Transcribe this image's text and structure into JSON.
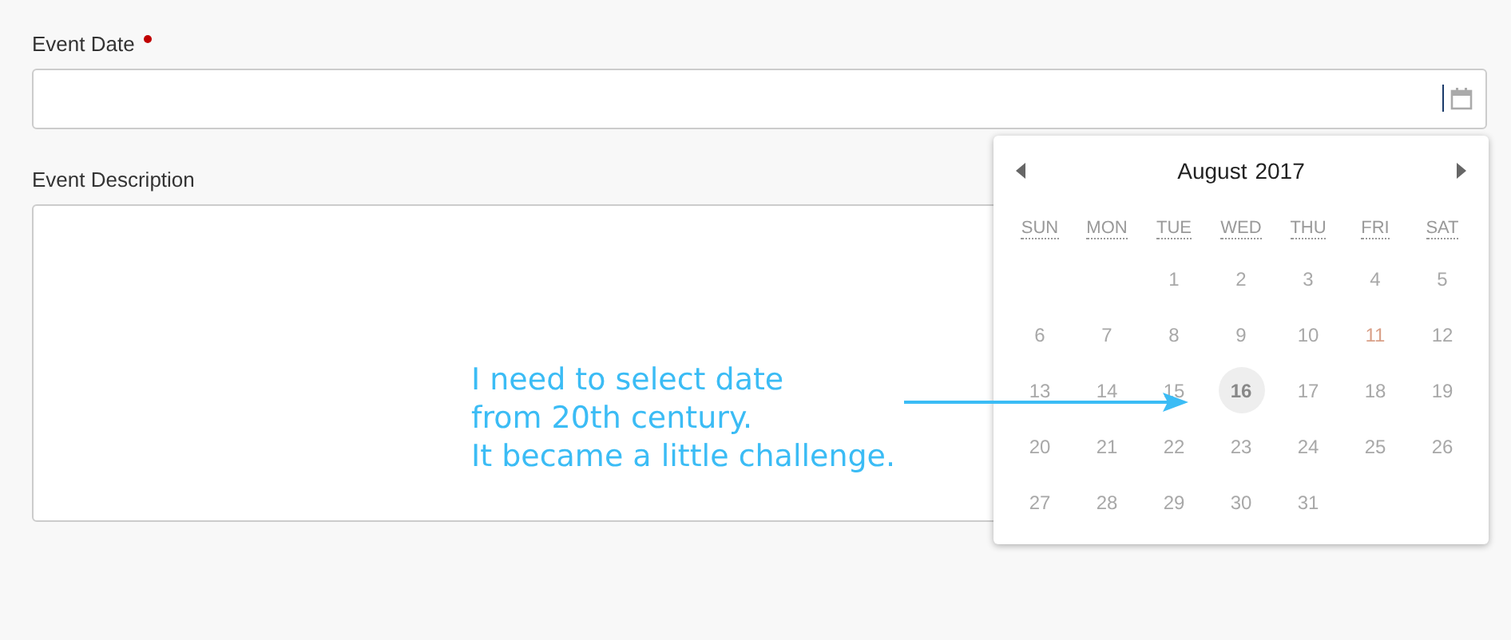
{
  "event_date": {
    "label": "Event Date",
    "required": true
  },
  "event_description": {
    "label": "Event Description"
  },
  "calendar": {
    "month": "August",
    "year": "2017",
    "weekdays": [
      "SUN",
      "MON",
      "TUE",
      "WED",
      "THU",
      "FRI",
      "SAT"
    ],
    "weeks": [
      {
        "days": [
          {
            "label": "1",
            "selected": false,
            "holiday": false
          },
          {
            "label": "2",
            "selected": false,
            "holiday": false
          },
          {
            "label": "3",
            "selected": false,
            "holiday": false
          },
          {
            "label": "4",
            "selected": false,
            "holiday": false
          },
          {
            "label": "5",
            "selected": false,
            "holiday": false
          }
        ]
      },
      {
        "days": [
          {
            "label": "6",
            "selected": false,
            "holiday": false
          },
          {
            "label": "7",
            "selected": false,
            "holiday": false
          },
          {
            "label": "8",
            "selected": false,
            "holiday": false
          },
          {
            "label": "9",
            "selected": false,
            "holiday": false
          },
          {
            "label": "10",
            "selected": false,
            "holiday": false
          },
          {
            "label": "11",
            "selected": false,
            "holiday": true
          },
          {
            "label": "12",
            "selected": false,
            "holiday": false
          }
        ]
      },
      {
        "days": [
          {
            "label": "13",
            "selected": false,
            "holiday": false
          },
          {
            "label": "14",
            "selected": false,
            "holiday": false
          },
          {
            "label": "15",
            "selected": false,
            "holiday": false
          },
          {
            "label": "16",
            "selected": true,
            "holiday": false
          },
          {
            "label": "17",
            "selected": false,
            "holiday": false
          },
          {
            "label": "18",
            "selected": false,
            "holiday": false
          },
          {
            "label": "19",
            "selected": false,
            "holiday": false
          }
        ]
      },
      {
        "days": [
          {
            "label": "20",
            "selected": false,
            "holiday": false
          },
          {
            "label": "21",
            "selected": false,
            "holiday": false
          },
          {
            "label": "22",
            "selected": false,
            "holiday": false
          },
          {
            "label": "23",
            "selected": false,
            "holiday": false
          },
          {
            "label": "24",
            "selected": false,
            "holiday": false
          },
          {
            "label": "25",
            "selected": false,
            "holiday": false
          },
          {
            "label": "26",
            "selected": false,
            "holiday": false
          }
        ]
      },
      {
        "days": [
          {
            "label": "27",
            "selected": false,
            "holiday": false
          },
          {
            "label": "28",
            "selected": false,
            "holiday": false
          },
          {
            "label": "29",
            "selected": false,
            "holiday": false
          },
          {
            "label": "30",
            "selected": false,
            "holiday": false
          },
          {
            "label": "31",
            "selected": false,
            "holiday": false
          }
        ]
      }
    ]
  },
  "annotation": {
    "lines": [
      "I need to select date",
      "from 20th century.",
      "It became a little challenge."
    ]
  }
}
